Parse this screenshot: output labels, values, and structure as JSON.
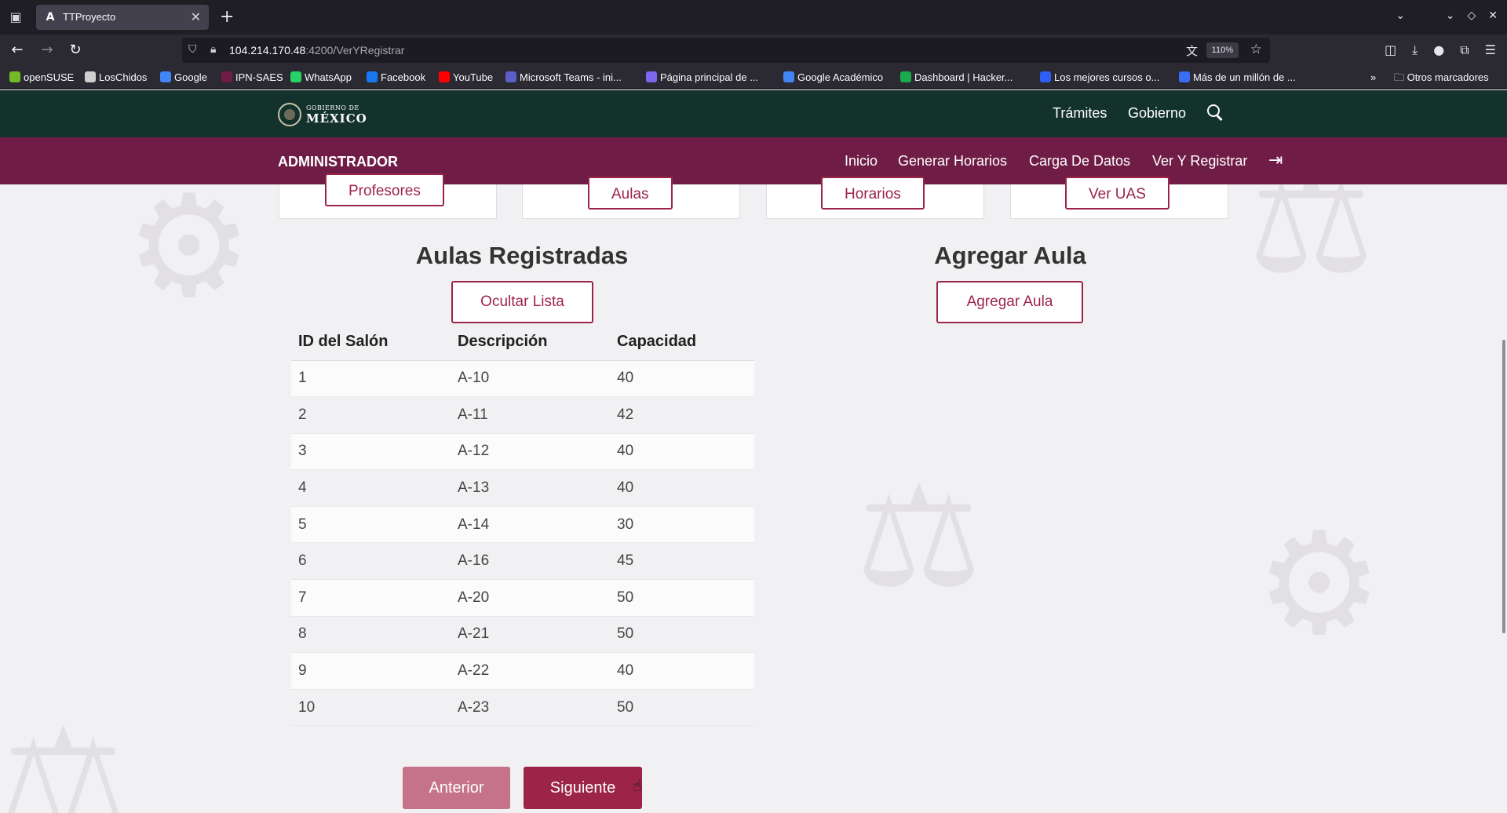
{
  "browser": {
    "tab_title": "TTProyecto",
    "tab_favicon": "A",
    "url_host": "104.214.170.48",
    "url_rest": ":4200/VerYRegistrar",
    "zoom": "110%",
    "bookmarks": [
      {
        "label": "openSUSE",
        "icon": "opensuse-icon",
        "color": "#73ba25"
      },
      {
        "label": "LosChidos",
        "icon": "github-icon",
        "color": "#cfcfcf"
      },
      {
        "label": "Google",
        "icon": "google-icon",
        "color": "#4285f4"
      },
      {
        "label": "IPN-SAES",
        "icon": "ipn-icon",
        "color": "#6f1d46"
      },
      {
        "label": "WhatsApp",
        "icon": "whatsapp-icon",
        "color": "#25d366"
      },
      {
        "label": "Facebook",
        "icon": "facebook-icon",
        "color": "#1877f2"
      },
      {
        "label": "YouTube",
        "icon": "youtube-icon",
        "color": "#ff0000"
      },
      {
        "label": "Microsoft Teams - ini...",
        "icon": "teams-icon",
        "color": "#5b5fc7"
      },
      {
        "label": "Página principal de ...",
        "icon": "page-icon",
        "color": "#7b68ee"
      },
      {
        "label": "Google Académico",
        "icon": "scholar-icon",
        "color": "#4285f4"
      },
      {
        "label": "Dashboard | Hacker...",
        "icon": "hackerrank-icon",
        "color": "#1ba94c"
      },
      {
        "label": "Los mejores cursos o...",
        "icon": "courses-icon",
        "color": "#2f5ef5"
      },
      {
        "label": "Más de un millón de ...",
        "icon": "cloud-icon",
        "color": "#3b6cf6"
      }
    ],
    "other_bookmarks": "Otros marcadores"
  },
  "gob": {
    "logo_small": "GOBIERNO DE",
    "logo_big": "MÉXICO",
    "links": [
      "Trámites",
      "Gobierno"
    ]
  },
  "admin": {
    "title": "ADMINISTRADOR",
    "nav": [
      "Inicio",
      "Generar Horarios",
      "Carga De Datos",
      "Ver Y Registrar"
    ]
  },
  "cards": [
    "Profesores",
    "Aulas",
    "Horarios",
    "Ver UAS"
  ],
  "aulas": {
    "title": "Aulas Registradas",
    "toggle_label": "Ocultar Lista",
    "columns": [
      "ID del Salón",
      "Descripción",
      "Capacidad"
    ],
    "rows": [
      [
        "1",
        "A-10",
        "40"
      ],
      [
        "2",
        "A-11",
        "42"
      ],
      [
        "3",
        "A-12",
        "40"
      ],
      [
        "4",
        "A-13",
        "40"
      ],
      [
        "5",
        "A-14",
        "30"
      ],
      [
        "6",
        "A-16",
        "45"
      ],
      [
        "7",
        "A-20",
        "50"
      ],
      [
        "8",
        "A-21",
        "50"
      ],
      [
        "9",
        "A-22",
        "40"
      ],
      [
        "10",
        "A-23",
        "50"
      ]
    ],
    "prev_label": "Anterior",
    "next_label": "Siguiente"
  },
  "agregar": {
    "title": "Agregar Aula",
    "button_label": "Agregar Aula"
  },
  "colors": {
    "gob_green": "#13322b",
    "admin_maroon": "#6f1d46",
    "accent": "#9d2449"
  }
}
